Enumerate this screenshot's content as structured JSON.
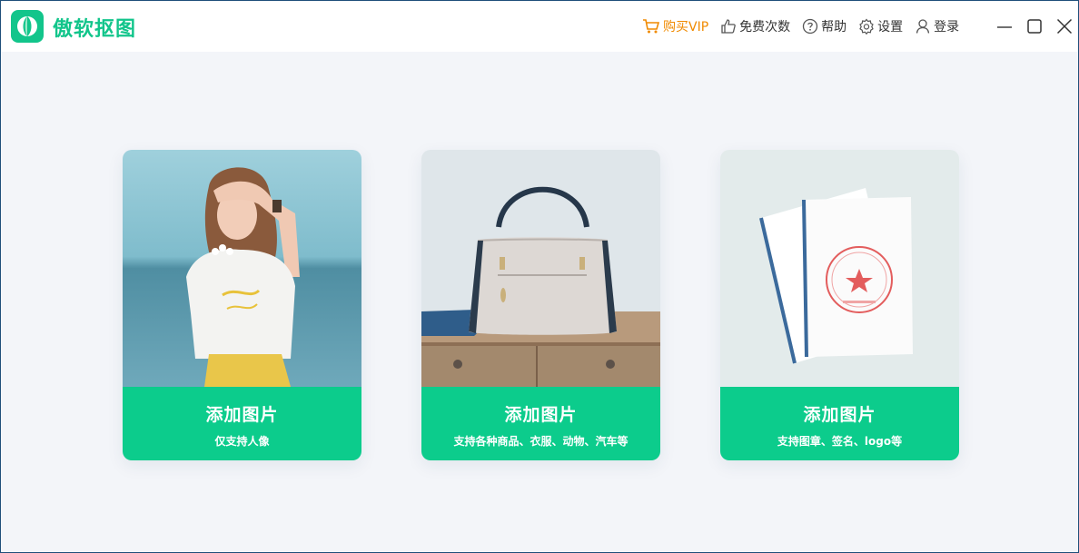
{
  "app": {
    "title": "傲软抠图",
    "accent_color": "#12c58b",
    "vip_color": "#f08a00"
  },
  "nav": {
    "vip": "购买VIP",
    "free_count": "免费次数",
    "help": "帮助",
    "settings": "设置",
    "login": "登录"
  },
  "window_controls": [
    "minimize-icon",
    "maximize-icon",
    "close-icon"
  ],
  "cards": [
    {
      "title": "添加图片",
      "subtitle": "仅支持人像",
      "image": "portrait-photo"
    },
    {
      "title": "添加图片",
      "subtitle": "支持各种商品、衣服、动物、汽车等",
      "image": "handbag-product-photo"
    },
    {
      "title": "添加图片",
      "subtitle": "支持图章、签名、logo等",
      "image": "stamped-document-photo"
    }
  ]
}
